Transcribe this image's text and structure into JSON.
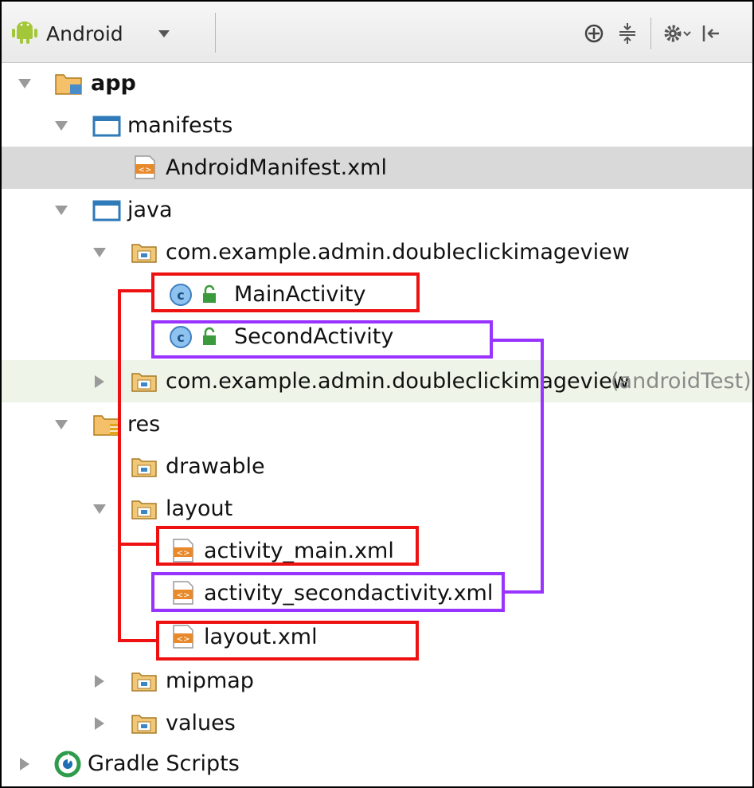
{
  "toolbar": {
    "view_selector": "Android",
    "icons": [
      "android-icon",
      "target-icon",
      "collapse-all-icon",
      "gear-icon",
      "hide-icon"
    ]
  },
  "tree": [
    {
      "label": "app",
      "bold": true
    },
    {
      "label": "manifests"
    },
    {
      "label": "AndroidManifest.xml",
      "selected": true
    },
    {
      "label": "java"
    },
    {
      "label": "com.example.admin.doubleclickimageview"
    },
    {
      "label": "MainActivity"
    },
    {
      "label": "SecondActivity"
    },
    {
      "label": "com.example.admin.doubleclickimageview",
      "suffix": "(androidTest)"
    },
    {
      "label": "res"
    },
    {
      "label": "drawable"
    },
    {
      "label": "layout"
    },
    {
      "label": "activity_main.xml"
    },
    {
      "label": "activity_secondactivity.xml"
    },
    {
      "label": "layout.xml"
    },
    {
      "label": "mipmap"
    },
    {
      "label": "values"
    },
    {
      "label": "Gradle Scripts"
    }
  ],
  "annotations": {
    "red_color": "#ee1111",
    "purple_color": "#9933ff"
  }
}
